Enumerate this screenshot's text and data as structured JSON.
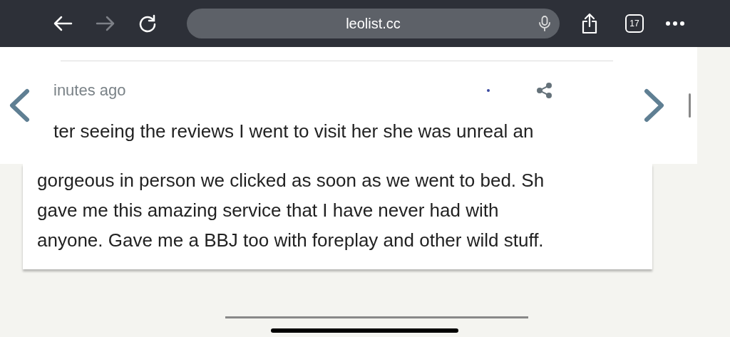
{
  "browser": {
    "url": "leolist.cc",
    "tab_count": "17",
    "forward_disabled": true
  },
  "overlay": {
    "time": "inutes ago",
    "text": "ter seeing the reviews I went to visit her she was unreal an"
  },
  "review": {
    "lines": [
      "gorgeous in person we clicked as soon as we went to bed. Sh",
      "gave me this amazing service that I have never had with",
      "anyone. Gave me a BBJ too with foreplay and other wild stuff."
    ]
  }
}
